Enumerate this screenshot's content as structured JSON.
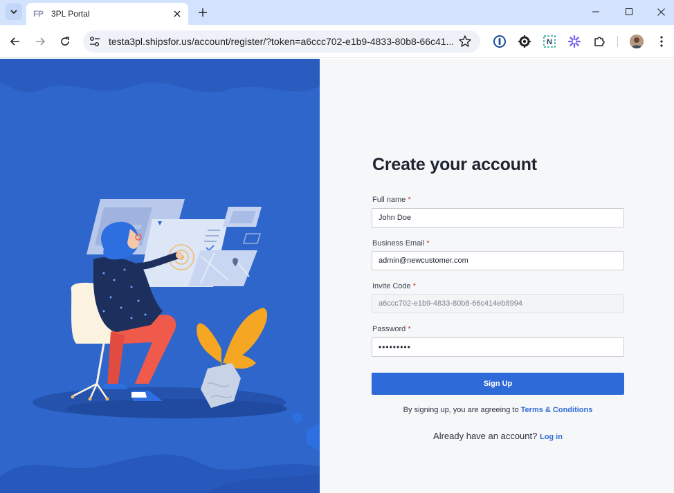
{
  "browser": {
    "tab": {
      "favicon_text": "FP",
      "title": "3PL Portal"
    },
    "url": "testa3pl.shipsfor.us/account/register/?token=a6ccc702-e1b9-4833-80b8-66c41..."
  },
  "form": {
    "title": "Create your account",
    "required_marker": "*",
    "full_name": {
      "label": "Full name",
      "value": "John Doe"
    },
    "email": {
      "label": "Business Email",
      "value": "admin@newcustomer.com"
    },
    "invite_code": {
      "label": "Invite Code",
      "value": "a6ccc702-e1b9-4833-80b8-66c414eb8994"
    },
    "password": {
      "label": "Password",
      "value": "•••••••••"
    },
    "submit_label": "Sign Up",
    "terms_prefix": "By signing up, you are agreeing to ",
    "terms_link": "Terms & Conditions",
    "login_prefix": "Already have an account? ",
    "login_link": "Log in"
  },
  "colors": {
    "brand": "#2f6bd8",
    "panel_blue": "#2e66cc",
    "required": "#d93025"
  }
}
